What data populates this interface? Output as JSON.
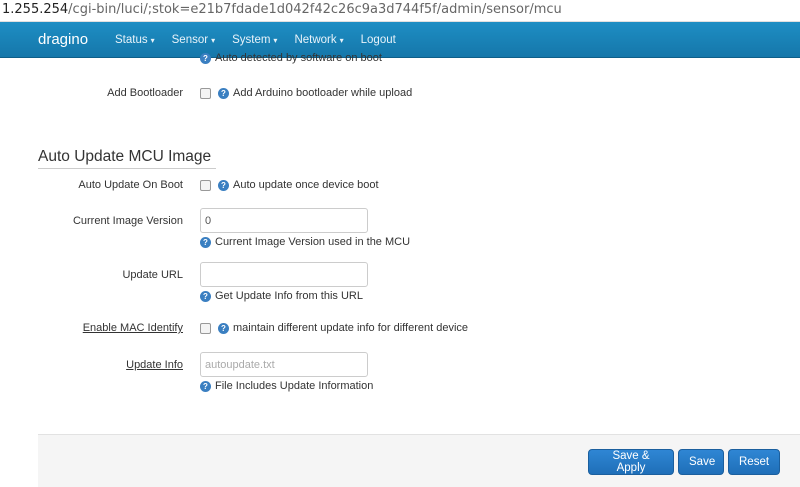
{
  "browser": {
    "url_host": "1.255.254",
    "url_path": "/cgi-bin/luci/;stok=e21b7fdade1d042f42c26c9a3d744f5f/admin/sensor/mcu"
  },
  "navbar": {
    "brand": "dragino",
    "menu": [
      {
        "label": "Status",
        "caret": "▾"
      },
      {
        "label": "Sensor",
        "caret": "▾"
      },
      {
        "label": "System",
        "caret": "▾"
      },
      {
        "label": "Network",
        "caret": "▾"
      },
      {
        "label": "Logout",
        "caret": ""
      }
    ]
  },
  "top_partial": {
    "desc": "Auto detected by software on boot"
  },
  "bootloader": {
    "label": "Add Bootloader",
    "desc": "Add Arduino bootloader while upload",
    "checked": false
  },
  "section": {
    "title": "Auto Update MCU Image"
  },
  "auto_update": {
    "label": "Auto Update On Boot",
    "desc": "Auto update once device boot",
    "checked": false
  },
  "image_version": {
    "label": "Current Image Version",
    "value": "0",
    "desc": "Current Image Version used in the MCU"
  },
  "update_url": {
    "label": "Update URL",
    "value": "",
    "desc": "Get Update Info from this URL"
  },
  "mac_identify": {
    "label": "Enable MAC Identify",
    "desc": "maintain different update info for different device",
    "checked": false
  },
  "update_info": {
    "label": "Update Info",
    "placeholder": "autoupdate.txt",
    "desc": "File Includes Update Information"
  },
  "footer": {
    "save_apply": "Save & Apply",
    "save": "Save",
    "reset": "Reset"
  },
  "help_glyph": "?"
}
